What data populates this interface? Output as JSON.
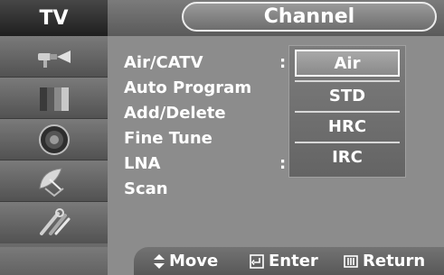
{
  "header": {
    "tv_label": "TV",
    "section_title": "Channel"
  },
  "sidebar": {
    "items": [
      {
        "icon": "antenna-plug-icon"
      },
      {
        "icon": "picture-bars-icon"
      },
      {
        "icon": "speaker-icon"
      },
      {
        "icon": "satellite-dish-icon"
      },
      {
        "icon": "tools-icon"
      }
    ]
  },
  "menu": {
    "items": [
      {
        "label": "Air/CATV",
        "has_colon": true
      },
      {
        "label": "Auto Program"
      },
      {
        "label": "Add/Delete"
      },
      {
        "label": "Fine Tune"
      },
      {
        "label": "LNA",
        "has_colon": true
      },
      {
        "label": "Scan"
      }
    ],
    "colon": ":"
  },
  "dropdown": {
    "options": [
      "Air",
      "STD",
      "HRC",
      "IRC"
    ],
    "selected": "Air"
  },
  "footer": {
    "move_label": "Move",
    "enter_label": "Enter",
    "return_label": "Return"
  }
}
